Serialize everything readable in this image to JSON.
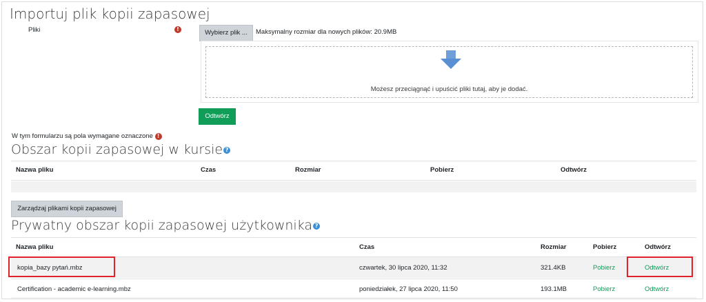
{
  "import": {
    "title": "Importuj plik kopii zapasowej",
    "files_label": "Pliki",
    "choose_button": "Wybierz plik ...",
    "max_size": "Maksymalny rozmiar dla nowych plików: 20.9MB",
    "drop_hint": "Możesz przeciągnąć i upuścić pliki tutaj, aby je dodać.",
    "restore_button": "Odtwórz",
    "required_note": "W tym formularzu są pola wymagane oznaczone"
  },
  "course_backups": {
    "title": "Obszar kopii zapasowej w kursie",
    "columns": [
      "Nazwa pliku",
      "Czas",
      "Rozmiar",
      "Pobierz",
      "Odtwórz"
    ],
    "manage_button": "Zarządzaj plikami kopii zapasowej"
  },
  "user_backups": {
    "title": "Prywatny obszar kopii zapasowej użytkownika",
    "columns": [
      "Nazwa pliku",
      "Czas",
      "Rozmiar",
      "Pobierz",
      "Odtwórz"
    ],
    "rows": [
      {
        "name": "kopia_bazy pytań.mbz",
        "time": "czwartek, 30 lipca 2020, 11:32",
        "size": "321.4KB",
        "download": "Pobierz",
        "restore": "Odtwórz"
      },
      {
        "name": "Certification - academic e-learning.mbz",
        "time": "poniedziałek, 27 lipca 2020, 11:50",
        "size": "193.1MB",
        "download": "Pobierz",
        "restore": "Odtwórz"
      }
    ]
  },
  "colors": {
    "accent_green": "#0f9d58",
    "highlight_red": "#e0202a",
    "help_blue": "#3a8fd6",
    "required_red": "#c0392b"
  }
}
